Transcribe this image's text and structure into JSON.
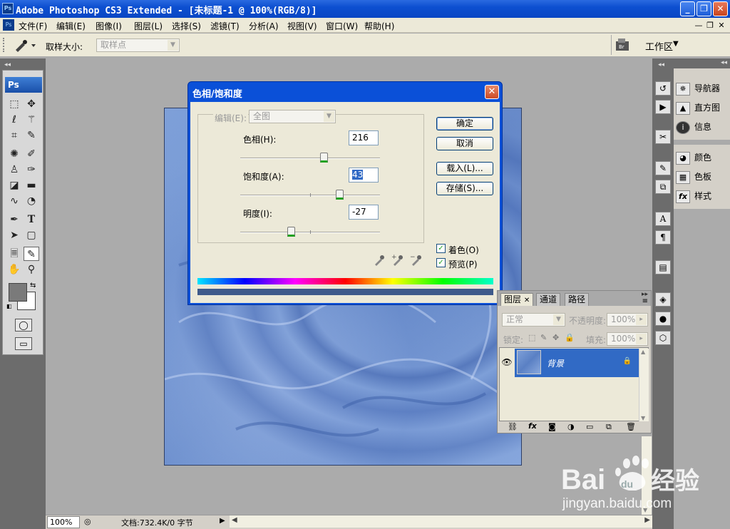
{
  "app": {
    "title": "Adobe Photoshop CS3 Extended - [未标题-1 @ 100%(RGB/8)]",
    "icon_text": "Ps",
    "window_buttons": [
      "_",
      "❐",
      "✕"
    ]
  },
  "menu": {
    "items": [
      "文件(F)",
      "编辑(E)",
      "图像(I)",
      "图层(L)",
      "选择(S)",
      "滤镜(T)",
      "分析(A)",
      "视图(V)",
      "窗口(W)",
      "帮助(H)"
    ],
    "doc_buttons": [
      "—",
      "❐",
      "✕"
    ]
  },
  "options": {
    "sample_size_label": "取样大小:",
    "sample_size_value": "取样点",
    "workspace_label": "工作区"
  },
  "toolbox": {
    "header": "Ps"
  },
  "right_panels": {
    "top_group": [
      "导航器",
      "直方图",
      "信息"
    ],
    "mid_group": [
      "颜色",
      "色板",
      "样式"
    ]
  },
  "dialog": {
    "title": "色相/饱和度",
    "edit_label": "编辑(E):",
    "edit_value": "全图",
    "hue_label": "色相(H):",
    "hue_value": "216",
    "saturation_label": "饱和度(A):",
    "saturation_value": "43",
    "lightness_label": "明度(I):",
    "lightness_value": "-27",
    "ok_button": "确定",
    "cancel_button": "取消",
    "load_button": "载入(L)...",
    "save_button": "存储(S)...",
    "colorize_label": "着色(O)",
    "colorize_checked": true,
    "preview_label": "预览(P)",
    "preview_checked": true,
    "result_bar_color": "#3e5a8a"
  },
  "layers_panel": {
    "tabs": [
      "图层",
      "通道",
      "路径"
    ],
    "blend_mode": "正常",
    "opacity_label": "不透明度:",
    "opacity_value": "100%",
    "lock_label": "锁定:",
    "fill_label": "填充:",
    "fill_value": "100%",
    "layer_name": "背景"
  },
  "status": {
    "zoom": "100%",
    "doc_info": "文档:732.4K/0 字节"
  },
  "watermark": {
    "brand": "Bai du 经验",
    "url": "jingyan.baidu.com"
  }
}
